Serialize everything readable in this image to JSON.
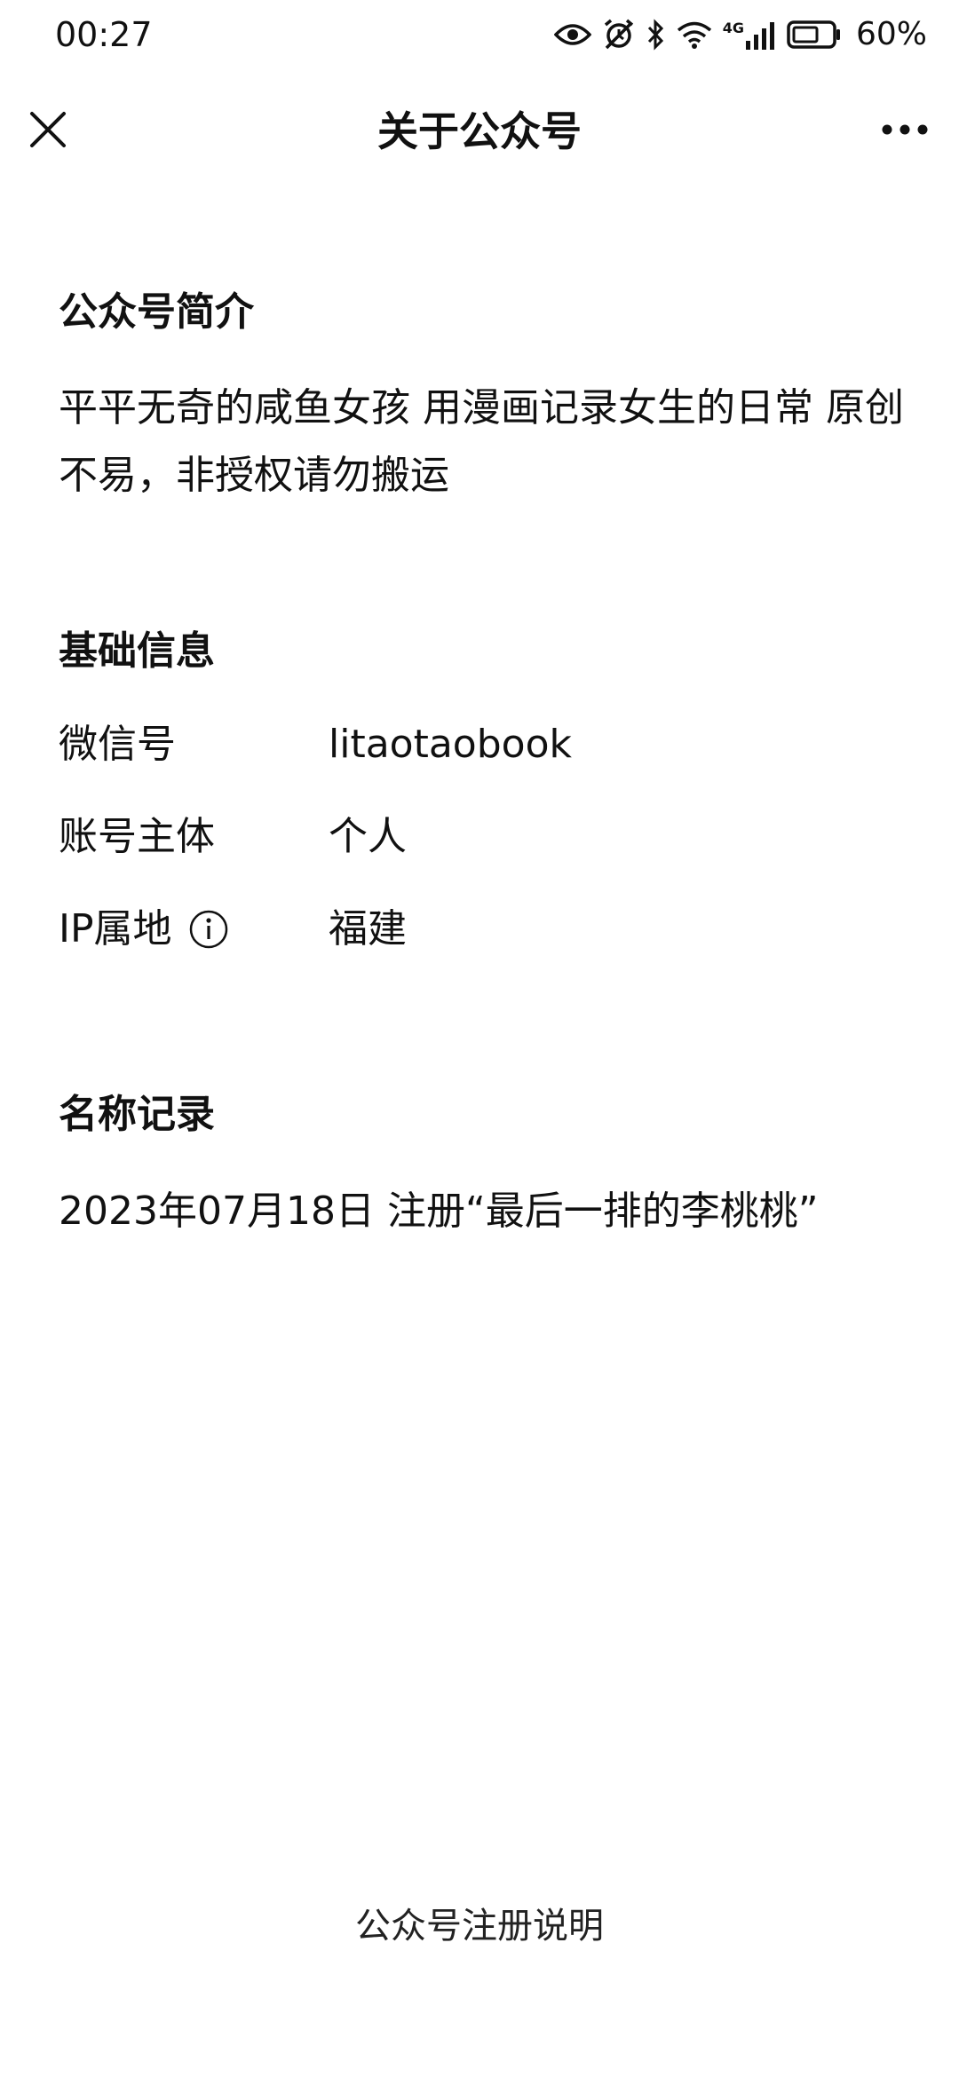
{
  "status_bar": {
    "time": "00:27",
    "network": "4G",
    "battery": "60%",
    "icons": [
      "eye-icon",
      "alarm-off-icon",
      "bluetooth-icon",
      "wifi-icon",
      "signal-icon",
      "battery-icon"
    ]
  },
  "nav": {
    "title": "关于公众号",
    "close_icon": "close-icon",
    "more_icon": "more-icon"
  },
  "intro": {
    "title": "公众号简介",
    "text": "平平无奇的咸鱼女孩 用漫画记录女生的日常 原创不易，非授权请勿搬运"
  },
  "basic_info": {
    "title": "基础信息",
    "rows": [
      {
        "label": "微信号",
        "value": "litaotaobook"
      },
      {
        "label": "账号主体",
        "value": "个人"
      },
      {
        "label": "IP属地",
        "value": "福建"
      }
    ]
  },
  "name_records": {
    "title": "名称记录",
    "items": [
      "2023年07月18日 注册“最后一排的李桃桃”"
    ]
  },
  "footer": {
    "link": "公众号注册说明"
  },
  "colors": {
    "text": "#111111",
    "background": "#ffffff"
  }
}
